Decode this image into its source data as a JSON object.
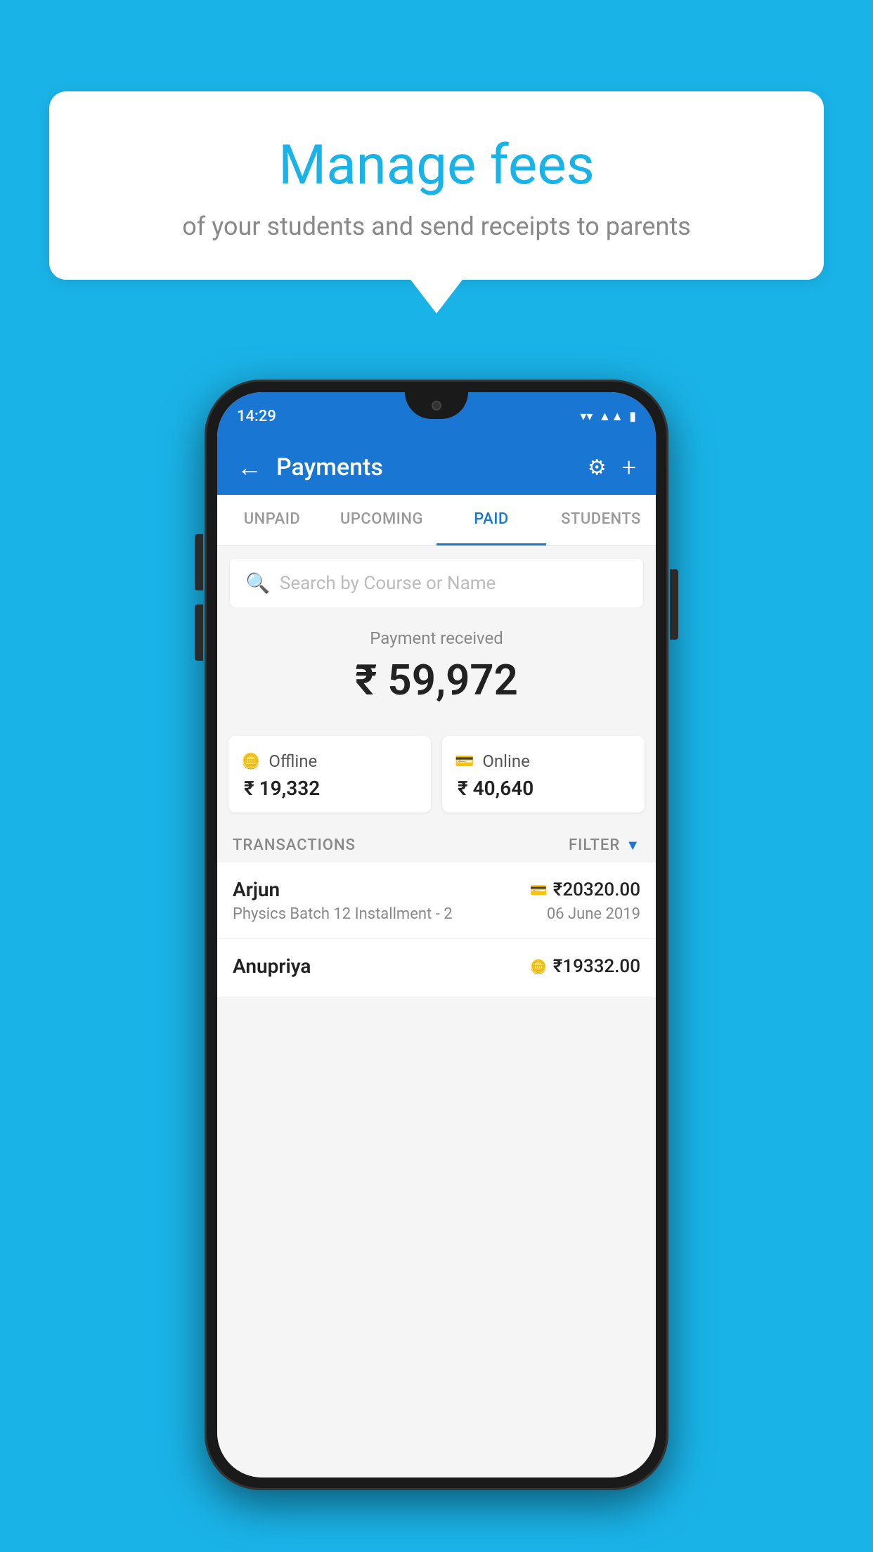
{
  "background_color": "#1ab3e8",
  "speech_bubble": {
    "title": "Manage fees",
    "subtitle": "of your students and send receipts to parents"
  },
  "status_bar": {
    "time": "14:29",
    "icons": [
      "wifi",
      "signal",
      "battery"
    ]
  },
  "app_bar": {
    "title": "Payments",
    "back_label": "←",
    "settings_icon": "⚙",
    "add_icon": "+"
  },
  "tabs": [
    {
      "label": "UNPAID",
      "active": false
    },
    {
      "label": "UPCOMING",
      "active": false
    },
    {
      "label": "PAID",
      "active": true
    },
    {
      "label": "STUDENTS",
      "active": false
    }
  ],
  "search": {
    "placeholder": "Search by Course or Name"
  },
  "payment_received": {
    "label": "Payment received",
    "amount": "₹ 59,972",
    "cards": [
      {
        "type": "Offline",
        "amount": "₹ 19,332",
        "icon": "offline"
      },
      {
        "type": "Online",
        "amount": "₹ 40,640",
        "icon": "online"
      }
    ]
  },
  "transactions": {
    "label": "TRANSACTIONS",
    "filter_label": "FILTER",
    "rows": [
      {
        "name": "Arjun",
        "course": "Physics Batch 12 Installment - 2",
        "amount": "₹20320.00",
        "date": "06 June 2019",
        "method": "online"
      },
      {
        "name": "Anupriya",
        "course": "",
        "amount": "₹19332.00",
        "date": "",
        "method": "offline"
      }
    ]
  }
}
